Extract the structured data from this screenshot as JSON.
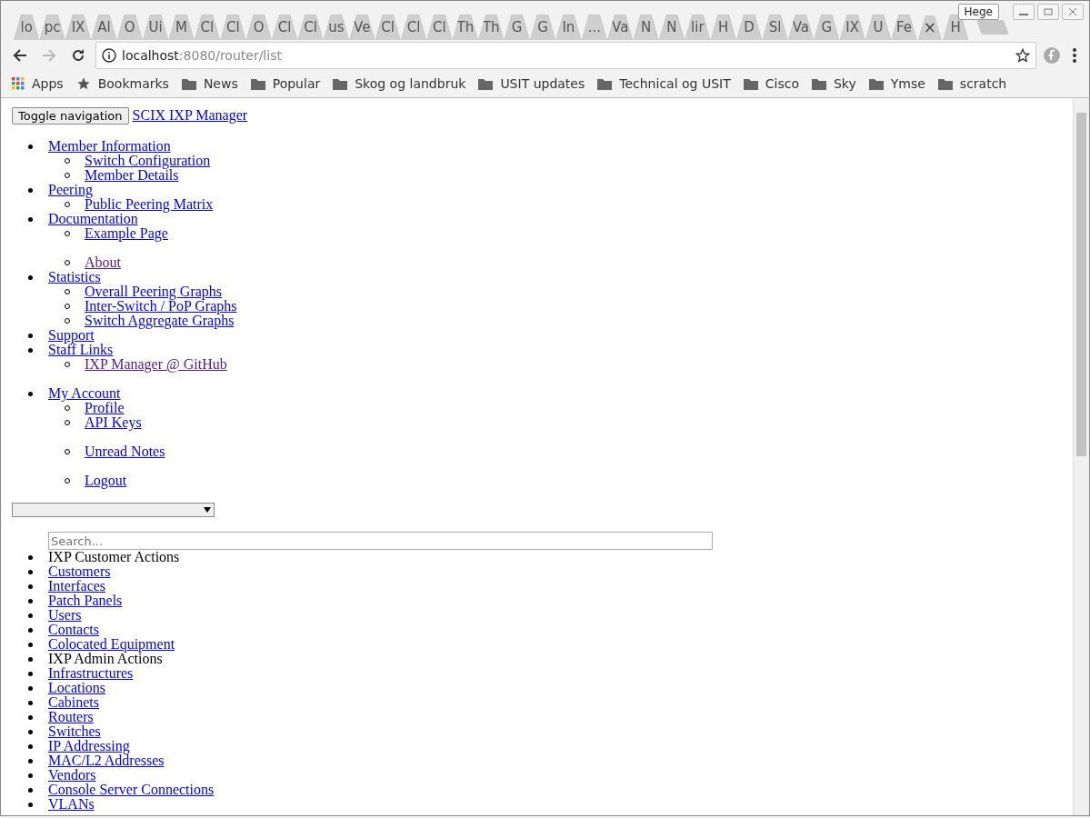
{
  "window": {
    "user_badge": "Hege"
  },
  "tabs": [
    {
      "label": "lo",
      "selected": false
    },
    {
      "label": "pc",
      "selected": false
    },
    {
      "label": "IX",
      "selected": false
    },
    {
      "label": "Al",
      "selected": false
    },
    {
      "label": "O",
      "selected": false
    },
    {
      "label": "Ui",
      "selected": false
    },
    {
      "label": "M",
      "selected": false
    },
    {
      "label": "Cl",
      "selected": false
    },
    {
      "label": "Cl",
      "selected": false
    },
    {
      "label": "O",
      "selected": false
    },
    {
      "label": "Cl",
      "selected": false
    },
    {
      "label": "Cl",
      "selected": false
    },
    {
      "label": "us",
      "selected": false
    },
    {
      "label": "Ve",
      "selected": false
    },
    {
      "label": "Cl",
      "selected": false
    },
    {
      "label": "Cl",
      "selected": false
    },
    {
      "label": "Cl",
      "selected": false
    },
    {
      "label": "Th",
      "selected": false
    },
    {
      "label": "Th",
      "selected": false
    },
    {
      "label": "G",
      "selected": false
    },
    {
      "label": "G",
      "selected": false
    },
    {
      "label": "In",
      "selected": false
    },
    {
      "label": "...",
      "selected": false
    },
    {
      "label": "Va",
      "selected": false
    },
    {
      "label": "N",
      "selected": false
    },
    {
      "label": "N",
      "selected": false
    },
    {
      "label": "lir",
      "selected": false
    },
    {
      "label": "H",
      "selected": false
    },
    {
      "label": "D",
      "selected": false
    },
    {
      "label": "Sl",
      "selected": false
    },
    {
      "label": "Va",
      "selected": false
    },
    {
      "label": "G",
      "selected": false
    },
    {
      "label": "IX",
      "selected": false
    },
    {
      "label": "U",
      "selected": false
    },
    {
      "label": "Fe",
      "selected": false
    },
    {
      "close": "×",
      "selected": true
    },
    {
      "label": "H",
      "selected": false
    }
  ],
  "address_bar": {
    "host": "localhost",
    "path": ":8080/router/list"
  },
  "bookmarks": [
    {
      "kind": "apps",
      "label": "Apps"
    },
    {
      "kind": "star",
      "label": "Bookmarks"
    },
    {
      "kind": "folder",
      "label": "News"
    },
    {
      "kind": "folder",
      "label": "Popular"
    },
    {
      "kind": "folder",
      "label": "Skog og landbruk"
    },
    {
      "kind": "folder",
      "label": "USIT updates"
    },
    {
      "kind": "folder",
      "label": "Technical og USIT"
    },
    {
      "kind": "folder",
      "label": "Cisco"
    },
    {
      "kind": "folder",
      "label": "Sky"
    },
    {
      "kind": "folder",
      "label": "Ymse"
    },
    {
      "kind": "folder",
      "label": "scratch"
    }
  ],
  "page": {
    "toggle_button": "Toggle navigation",
    "brand": "SCIX IXP Manager",
    "nav_menus": [
      [
        {
          "label": "Member Information",
          "visited": false,
          "children": [
            {
              "kind": "link",
              "label": "Switch Configuration",
              "visited": false
            },
            {
              "kind": "link",
              "label": "Member Details",
              "visited": false
            }
          ]
        },
        {
          "label": "Peering",
          "visited": false,
          "children": [
            {
              "kind": "link",
              "label": "Public Peering Matrix",
              "visited": false
            }
          ]
        },
        {
          "label": "Documentation",
          "visited": false,
          "children": [
            {
              "kind": "link",
              "label": "Example Page",
              "visited": false
            },
            {
              "kind": "divider"
            },
            {
              "kind": "link",
              "label": "About",
              "visited": true
            }
          ]
        },
        {
          "label": "Statistics",
          "visited": false,
          "children": [
            {
              "kind": "link",
              "label": "Overall Peering Graphs",
              "visited": false
            },
            {
              "kind": "link",
              "label": "Inter-Switch / PoP Graphs",
              "visited": false
            },
            {
              "kind": "link",
              "label": "Switch Aggregate Graphs",
              "visited": false
            }
          ]
        },
        {
          "label": "Support",
          "visited": false
        },
        {
          "label": "Staff Links",
          "visited": false,
          "children": [
            {
              "kind": "link",
              "label": "IXP Manager @ GitHub",
              "visited": true
            }
          ]
        }
      ],
      [
        {
          "label": "My Account",
          "visited": false,
          "children": [
            {
              "kind": "link",
              "label": "Profile",
              "visited": false
            },
            {
              "kind": "link",
              "label": "API Keys",
              "visited": false
            },
            {
              "kind": "divider"
            },
            {
              "kind": "link",
              "label": "Unread Notes",
              "visited": false
            },
            {
              "kind": "divider"
            },
            {
              "kind": "link",
              "label": "Logout",
              "visited": false
            }
          ]
        }
      ]
    ],
    "search": {
      "placeholder": "Search..."
    },
    "sidebar": [
      {
        "kind": "header",
        "label": "IXP Customer Actions"
      },
      {
        "kind": "link",
        "label": "Customers"
      },
      {
        "kind": "link",
        "label": "Interfaces"
      },
      {
        "kind": "link",
        "label": "Patch Panels"
      },
      {
        "kind": "link",
        "label": "Users"
      },
      {
        "kind": "link",
        "label": "Contacts"
      },
      {
        "kind": "link",
        "label": "Colocated Equipment"
      },
      {
        "kind": "header",
        "label": "IXP Admin Actions"
      },
      {
        "kind": "link",
        "label": "Infrastructures"
      },
      {
        "kind": "link",
        "label": "Locations"
      },
      {
        "kind": "link",
        "label": "Cabinets"
      },
      {
        "kind": "link",
        "label": "Routers"
      },
      {
        "kind": "link",
        "label": "Switches"
      },
      {
        "kind": "link",
        "label": "IP Addressing"
      },
      {
        "kind": "link",
        "label": "MAC/L2 Addresses"
      },
      {
        "kind": "link",
        "label": "Vendors"
      },
      {
        "kind": "link",
        "label": "Console Server Connections"
      },
      {
        "kind": "link",
        "label": "VLANs"
      }
    ]
  }
}
